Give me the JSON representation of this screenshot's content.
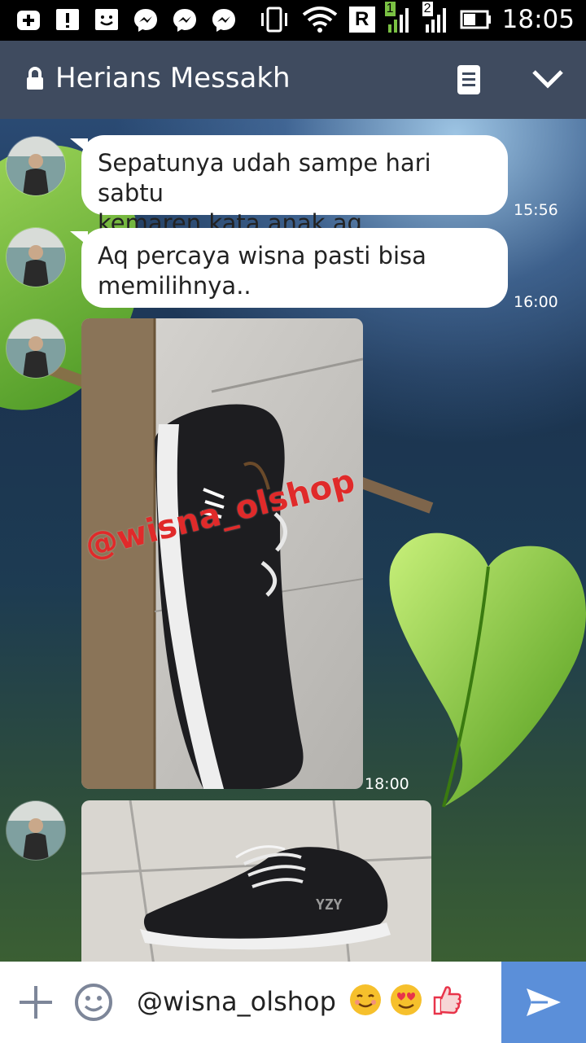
{
  "status_bar": {
    "time": "18:05",
    "icons": [
      "add-box-icon",
      "alert-icon",
      "emoji-face-icon",
      "messenger-icon",
      "messenger-icon",
      "messenger-icon",
      "vibrate-icon",
      "wifi-icon",
      "roaming-icon",
      "signal-icon",
      "signal-icon",
      "battery-icon"
    ],
    "roaming_label": "R",
    "sim1_label": "1",
    "sim2_label": "2"
  },
  "header": {
    "title": "Herians Messakh",
    "lock_icon": "lock-icon",
    "menu_icon": "notes-icon",
    "collapse_icon": "chevron-down-icon",
    "bg_color": "#3f4b5f"
  },
  "messages": [
    {
      "type": "text",
      "text_line1": " Sepatunya udah sampe hari sabtu",
      "text_line2": "kemaren kata anak aq..",
      "time": "15:56"
    },
    {
      "type": "text",
      "text_line1": "Aq percaya wisna pasti bisa",
      "text_line2": "memilihnya..",
      "time": "16:00"
    },
    {
      "type": "image",
      "watermark": "@wisna_olshop",
      "shoe_logo": "adidas",
      "time": "18:00"
    },
    {
      "type": "image",
      "shoe_logo": "YZY"
    }
  ],
  "input": {
    "value": "@wisna_olshop",
    "emojis": [
      "😊",
      "😍",
      "👍"
    ],
    "send_color": "#5b8fd9"
  }
}
